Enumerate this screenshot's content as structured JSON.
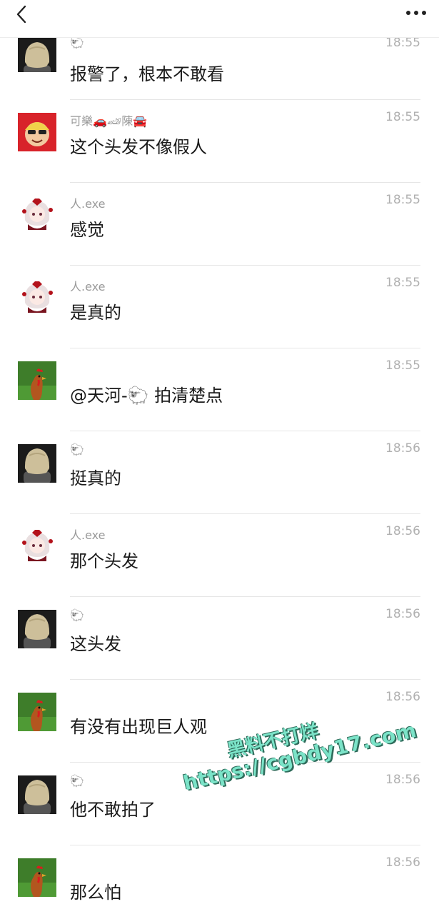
{
  "header": {
    "back_icon": "chevron-left-icon",
    "more_icon": "more-dots-icon"
  },
  "messages": [
    {
      "sender": "🐑",
      "avatar": "bob-hair-avatar",
      "time": "18:55",
      "text": "报警了，根本不敢看"
    },
    {
      "sender": "可樂🚗🏎陳🚘",
      "avatar": "cartoon-man-avatar",
      "time": "18:55",
      "text": "这个头发不像假人"
    },
    {
      "sender": "人.exe",
      "avatar": "anime-girl-avatar",
      "time": "18:55",
      "text": "感觉"
    },
    {
      "sender": "人.exe",
      "avatar": "anime-girl-avatar",
      "time": "18:55",
      "text": "是真的"
    },
    {
      "sender": "",
      "avatar": "rooster-avatar",
      "time": "18:55",
      "text": "@天河-🐑 拍清楚点"
    },
    {
      "sender": "🐑",
      "avatar": "bob-hair-avatar",
      "time": "18:56",
      "text": "挺真的"
    },
    {
      "sender": "人.exe",
      "avatar": "anime-girl-avatar",
      "time": "18:56",
      "text": "那个头发"
    },
    {
      "sender": "🐑",
      "avatar": "bob-hair-avatar",
      "time": "18:56",
      "text": "这头发"
    },
    {
      "sender": "",
      "avatar": "rooster-avatar",
      "time": "18:56",
      "text": "有没有出现巨人观"
    },
    {
      "sender": "🐑",
      "avatar": "bob-hair-avatar",
      "time": "18:56",
      "text": "他不敢拍了"
    },
    {
      "sender": "",
      "avatar": "rooster-avatar",
      "time": "18:56",
      "text": "那么怕"
    }
  ],
  "watermark": {
    "line1": "黑料不打烊",
    "line2": "https://cgbdy17.com"
  }
}
